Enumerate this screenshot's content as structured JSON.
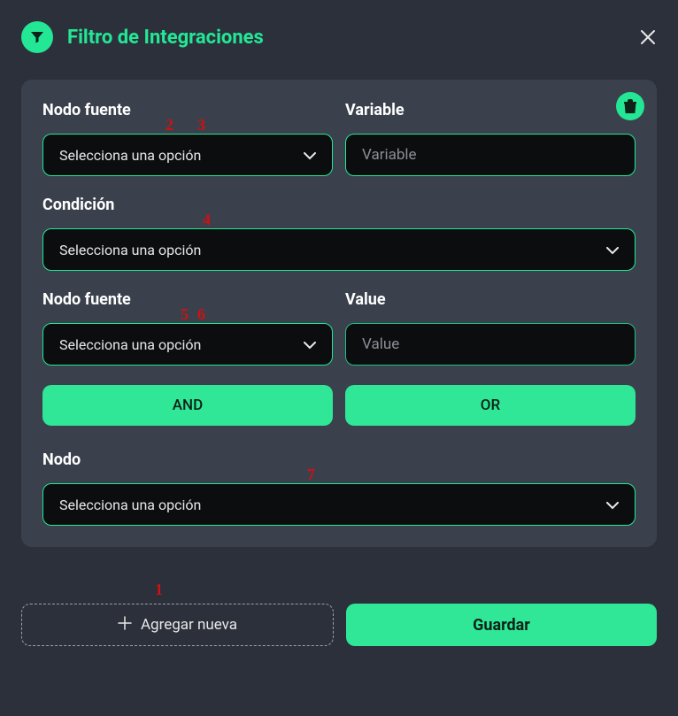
{
  "header": {
    "title": "Filtro de Integraciones"
  },
  "card": {
    "field1": {
      "label": "Nodo fuente",
      "value": "Selecciona una opción"
    },
    "field2": {
      "label": "Variable",
      "placeholder": "Variable"
    },
    "field3": {
      "label": "Condición",
      "value": "Selecciona una opción"
    },
    "field4": {
      "label": "Nodo fuente",
      "value": "Selecciona una opción"
    },
    "field5": {
      "label": "Value",
      "placeholder": "Value"
    },
    "logic": {
      "and": "AND",
      "or": "OR"
    },
    "field6": {
      "label": "Nodo",
      "value": "Selecciona una opción"
    }
  },
  "footer": {
    "add": "Agregar nueva",
    "save": "Guardar"
  },
  "annotations": {
    "a1": "1",
    "a2": "2",
    "a3": "3",
    "a4": "4",
    "a5": "5",
    "a6": "6",
    "a7": "7"
  }
}
